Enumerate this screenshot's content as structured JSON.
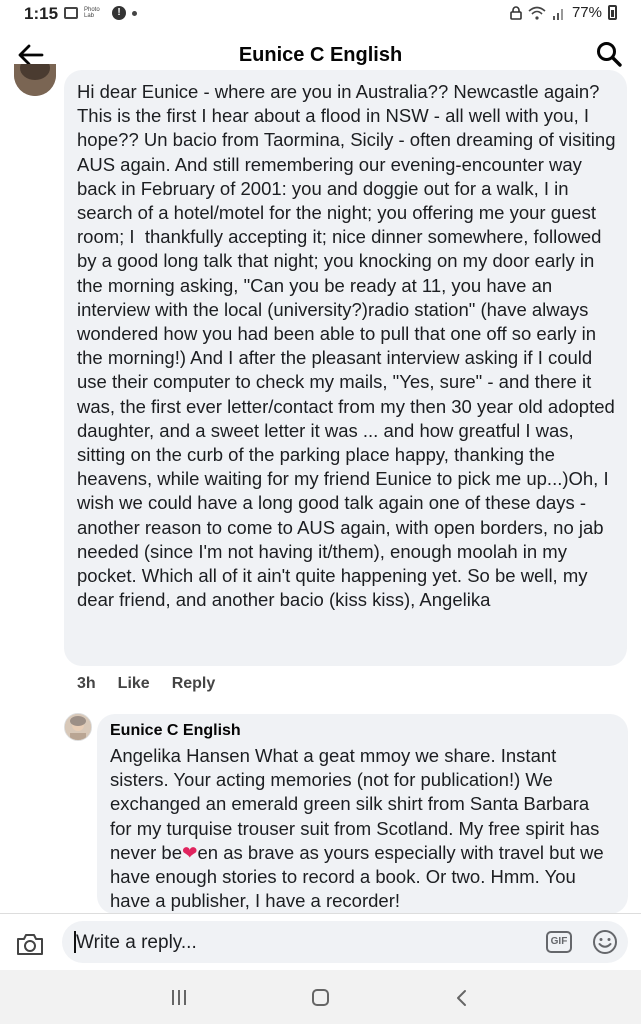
{
  "status_bar": {
    "time": "1:15",
    "photo_lab_label": "Photo\nLab",
    "notif_icon_label": "!",
    "battery": "77%"
  },
  "header": {
    "title": "Eunice C English"
  },
  "comment": {
    "text": "Hi dear Eunice - where are you in Australia?? Newcastle again? This is the first I hear about a flood in NSW - all well with you, I hope?? Un bacio from Taormina, Sicily - often dreaming of visiting AUS again. And still remembering our evening-encounter way back in February of 2001: you and doggie out for a walk, I in search of a hotel/motel for the night; you offering me your guest room; I  thankfully accepting it; nice dinner somewhere, followed by a good long talk that night; you knocking on my door early in the morning asking, \"Can you be ready at 11, you have an interview with the local (university?)radio station\" (have always wondered how you had been able to pull that one off so early in the morning!) And I after the pleasant interview asking if I could use their computer to check my mails, \"Yes, sure\" - and there it was, the first ever letter/contact from my then 30 year old adopted daughter, and a sweet letter it was ... and how greatful I was, sitting on the curb of the parking place happy, thanking the heavens, while waiting for my friend Eunice to pick me up...)Oh, I wish we could have a long good talk again one of these days - another reason to come to AUS again, with open borders, no jab needed (since I'm not having it/them), enough moolah in my pocket. Which all of it ain't quite happening yet. So be well, my dear friend, and another bacio (kiss kiss), Angelika",
    "time": "3h",
    "like_label": "Like",
    "reply_label": "Reply"
  },
  "reply": {
    "author": "Eunice C English",
    "text_before_emoji": "Angelika Hansen What a geat mmoy we share. Instant sisters. Your acting memories (not for publication!) We exchanged an emerald green silk shirt from Santa Barbara for my turquise trouser suit from Scotland. My free spirit has never be",
    "emoji": "❤",
    "text_after_emoji": "en as brave as yours especially with travel but we have enough stories to record a book. Or two. Hmm. You have a publisher, I have a recorder!"
  },
  "composer": {
    "placeholder": "Write a reply...",
    "gif_label": "GIF"
  },
  "icons": {
    "back": "arrow-left-icon",
    "search": "search-icon",
    "camera": "camera-icon",
    "emoji": "smiley-icon",
    "nav_recent": "recent-apps-icon",
    "nav_home": "home-icon",
    "nav_back": "chevron-left-icon"
  },
  "colors": {
    "bubble": "#f0f2f5",
    "text": "#1c1e21",
    "emoji": "#e0245e"
  }
}
